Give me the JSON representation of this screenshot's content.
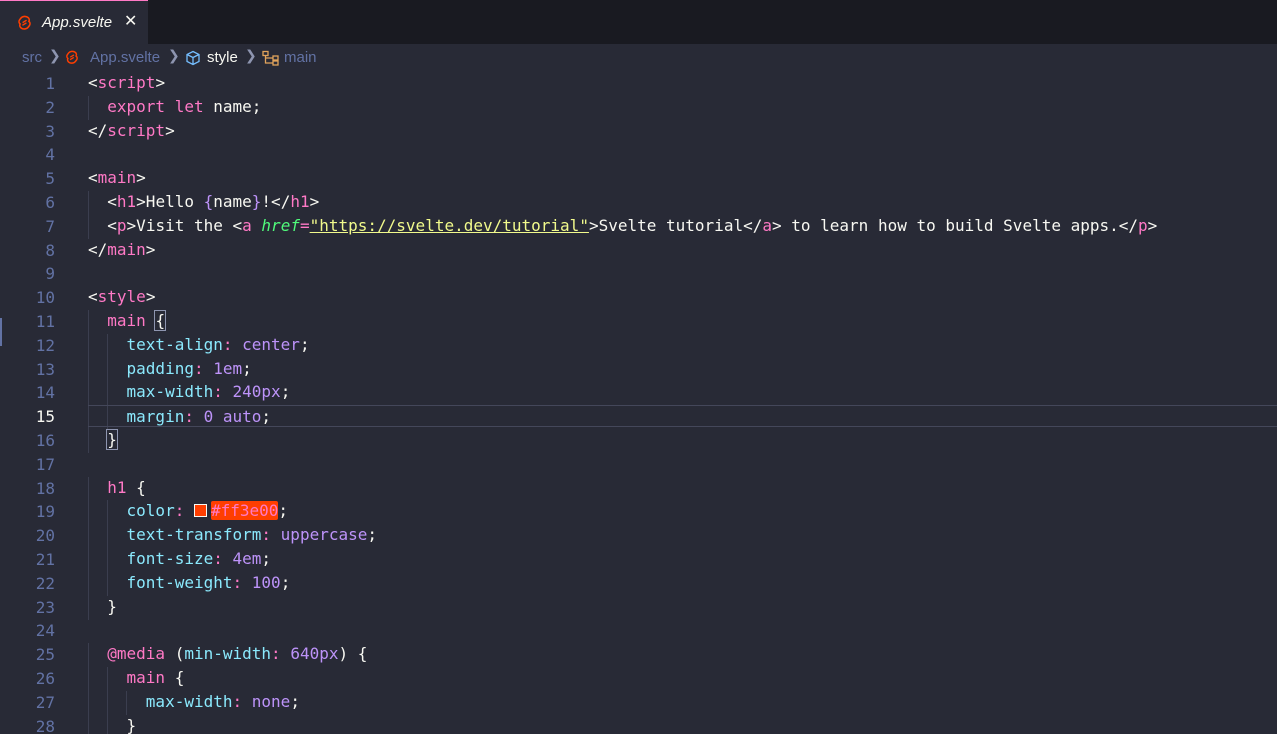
{
  "tab": {
    "label": "App.svelte",
    "close_glyph": "✕",
    "icon": "svelte-icon"
  },
  "breadcrumb": {
    "items": [
      {
        "label": "src",
        "icon": ""
      },
      {
        "label": "App.svelte",
        "icon": "svelte-icon"
      },
      {
        "label": "style",
        "icon": "cube-icon"
      },
      {
        "label": "main",
        "icon": "symbol-tree-icon"
      }
    ],
    "separator": "❯"
  },
  "editor": {
    "current_line": 15,
    "colors": {
      "tag": "#ff79c6",
      "attribute": "#50fa7b",
      "string": "#f1fa8c",
      "property": "#8be9fd",
      "value": "#bd93f9",
      "swatch": "#ff3e00"
    },
    "lines": [
      {
        "n": "1",
        "indent": 0,
        "tokens": [
          [
            "plain",
            "<"
          ],
          [
            "tag",
            "script"
          ],
          [
            "plain",
            ">"
          ]
        ]
      },
      {
        "n": "2",
        "indent": 1,
        "tokens": [
          [
            "kw",
            "export"
          ],
          [
            "plain",
            " "
          ],
          [
            "kw",
            "let"
          ],
          [
            "plain",
            " name;"
          ]
        ]
      },
      {
        "n": "3",
        "indent": 0,
        "tokens": [
          [
            "plain",
            "</"
          ],
          [
            "tag",
            "script"
          ],
          [
            "plain",
            ">"
          ]
        ]
      },
      {
        "n": "4",
        "indent": 0,
        "tokens": []
      },
      {
        "n": "5",
        "indent": 0,
        "tokens": [
          [
            "plain",
            "<"
          ],
          [
            "tag",
            "main"
          ],
          [
            "plain",
            ">"
          ]
        ]
      },
      {
        "n": "6",
        "indent": 1,
        "tokens": [
          [
            "plain",
            "<"
          ],
          [
            "tag",
            "h1"
          ],
          [
            "plain",
            ">Hello "
          ],
          [
            "val",
            "{"
          ],
          [
            "plain",
            "name"
          ],
          [
            "val",
            "}"
          ],
          [
            "plain",
            "!</"
          ],
          [
            "tag",
            "h1"
          ],
          [
            "plain",
            ">"
          ]
        ]
      },
      {
        "n": "7",
        "indent": 1,
        "tokens": [
          [
            "plain",
            "<"
          ],
          [
            "tag",
            "p"
          ],
          [
            "plain",
            ">Visit the <"
          ],
          [
            "tag",
            "a"
          ],
          [
            "plain",
            " "
          ],
          [
            "attr",
            "href"
          ],
          [
            "tag",
            "="
          ],
          [
            "str",
            "\"https://svelte.dev/tutorial\""
          ],
          [
            "plain",
            ">Svelte tutorial</"
          ],
          [
            "tag",
            "a"
          ],
          [
            "plain",
            "> to learn how to build Svelte apps.</"
          ],
          [
            "tag",
            "p"
          ],
          [
            "plain",
            ">"
          ]
        ]
      },
      {
        "n": "8",
        "indent": 0,
        "tokens": [
          [
            "plain",
            "</"
          ],
          [
            "tag",
            "main"
          ],
          [
            "plain",
            ">"
          ]
        ]
      },
      {
        "n": "9",
        "indent": 0,
        "tokens": []
      },
      {
        "n": "10",
        "indent": 0,
        "tokens": [
          [
            "plain",
            "<"
          ],
          [
            "tag",
            "style"
          ],
          [
            "plain",
            ">"
          ]
        ]
      },
      {
        "n": "11",
        "indent": 1,
        "tokens": [
          [
            "tag",
            "main"
          ],
          [
            "plain",
            " "
          ],
          [
            "brace",
            "{"
          ]
        ]
      },
      {
        "n": "12",
        "indent": 2,
        "tokens": [
          [
            "prop",
            "text-align"
          ],
          [
            "tag",
            ":"
          ],
          [
            "plain",
            " "
          ],
          [
            "val",
            "center"
          ],
          [
            "plain",
            ";"
          ]
        ]
      },
      {
        "n": "13",
        "indent": 2,
        "tokens": [
          [
            "prop",
            "padding"
          ],
          [
            "tag",
            ":"
          ],
          [
            "plain",
            " "
          ],
          [
            "val",
            "1em"
          ],
          [
            "plain",
            ";"
          ]
        ]
      },
      {
        "n": "14",
        "indent": 2,
        "tokens": [
          [
            "prop",
            "max-width"
          ],
          [
            "tag",
            ":"
          ],
          [
            "plain",
            " "
          ],
          [
            "val",
            "240px"
          ],
          [
            "plain",
            ";"
          ]
        ]
      },
      {
        "n": "15",
        "indent": 2,
        "tokens": [
          [
            "prop",
            "margin"
          ],
          [
            "tag",
            ":"
          ],
          [
            "plain",
            " "
          ],
          [
            "val",
            "0"
          ],
          [
            "plain",
            " "
          ],
          [
            "val",
            "auto"
          ],
          [
            "plain",
            ";"
          ]
        ]
      },
      {
        "n": "16",
        "indent": 1,
        "tokens": [
          [
            "brace",
            "}"
          ]
        ]
      },
      {
        "n": "17",
        "indent": 0,
        "tokens": []
      },
      {
        "n": "18",
        "indent": 1,
        "tokens": [
          [
            "tag",
            "h1"
          ],
          [
            "plain",
            " {"
          ]
        ]
      },
      {
        "n": "19",
        "indent": 2,
        "tokens": [
          [
            "prop",
            "color"
          ],
          [
            "tag",
            ":"
          ],
          [
            "plain",
            " "
          ],
          [
            "swatch",
            ""
          ],
          [
            "hex",
            "#ff3e00"
          ],
          [
            "plain",
            ";"
          ]
        ]
      },
      {
        "n": "20",
        "indent": 2,
        "tokens": [
          [
            "prop",
            "text-transform"
          ],
          [
            "tag",
            ":"
          ],
          [
            "plain",
            " "
          ],
          [
            "val",
            "uppercase"
          ],
          [
            "plain",
            ";"
          ]
        ]
      },
      {
        "n": "21",
        "indent": 2,
        "tokens": [
          [
            "prop",
            "font-size"
          ],
          [
            "tag",
            ":"
          ],
          [
            "plain",
            " "
          ],
          [
            "val",
            "4em"
          ],
          [
            "plain",
            ";"
          ]
        ]
      },
      {
        "n": "22",
        "indent": 2,
        "tokens": [
          [
            "prop",
            "font-weight"
          ],
          [
            "tag",
            ":"
          ],
          [
            "plain",
            " "
          ],
          [
            "val",
            "100"
          ],
          [
            "plain",
            ";"
          ]
        ]
      },
      {
        "n": "23",
        "indent": 1,
        "tokens": [
          [
            "plain",
            "}"
          ]
        ]
      },
      {
        "n": "24",
        "indent": 0,
        "tokens": []
      },
      {
        "n": "25",
        "indent": 1,
        "tokens": [
          [
            "kw",
            "@media"
          ],
          [
            "plain",
            " ("
          ],
          [
            "prop",
            "min-width"
          ],
          [
            "tag",
            ":"
          ],
          [
            "plain",
            " "
          ],
          [
            "val",
            "640px"
          ],
          [
            "plain",
            ") {"
          ]
        ]
      },
      {
        "n": "26",
        "indent": 2,
        "tokens": [
          [
            "tag",
            "main"
          ],
          [
            "plain",
            " {"
          ]
        ]
      },
      {
        "n": "27",
        "indent": 3,
        "tokens": [
          [
            "prop",
            "max-width"
          ],
          [
            "tag",
            ":"
          ],
          [
            "plain",
            " "
          ],
          [
            "val",
            "none"
          ],
          [
            "plain",
            ";"
          ]
        ]
      },
      {
        "n": "28",
        "indent": 2,
        "tokens": [
          [
            "plain",
            "}"
          ]
        ]
      }
    ]
  }
}
